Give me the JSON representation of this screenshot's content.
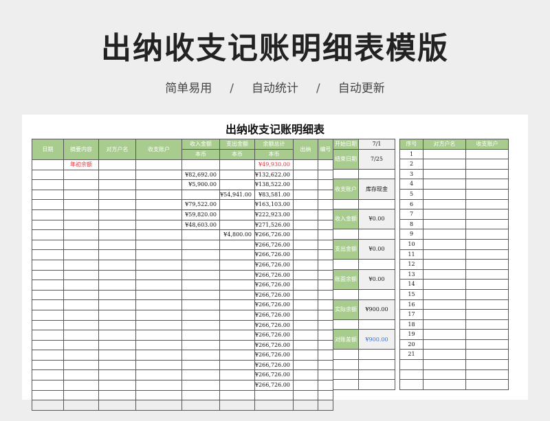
{
  "header": {
    "title": "出纳收支记账明细表模版",
    "tags": [
      "简单易用",
      "自动统计",
      "自动更新"
    ],
    "sep": "/"
  },
  "sheet": {
    "title": "出纳收支记账明细表",
    "columns": [
      "日期",
      "摘要内容",
      "对方户名",
      "收支账户",
      "收入金额",
      "支出金额",
      "余额总计",
      "出纳",
      "编号"
    ],
    "sub_currency": "本币",
    "opening_label": "年初余额",
    "opening_balance": "¥49,930.00",
    "rows": [
      {
        "income": "¥82,692.00",
        "expense": "",
        "balance": "¥132,622.00"
      },
      {
        "income": "¥5,900.00",
        "expense": "",
        "balance": "¥138,522.00"
      },
      {
        "income": "",
        "expense": "¥54,941.00",
        "balance": "¥83,581.00"
      },
      {
        "income": "¥79,522.00",
        "expense": "",
        "balance": "¥163,103.00"
      },
      {
        "income": "¥59,820.00",
        "expense": "",
        "balance": "¥222,923.00"
      },
      {
        "income": "¥48,603.00",
        "expense": "",
        "balance": "¥271,526.00"
      },
      {
        "income": "",
        "expense": "¥4,800.00",
        "balance": "¥266,726.00"
      },
      {
        "income": "",
        "expense": "",
        "balance": "¥266,726.00"
      },
      {
        "income": "",
        "expense": "",
        "balance": "¥266,726.00"
      },
      {
        "income": "",
        "expense": "",
        "balance": "¥266,726.00"
      },
      {
        "income": "",
        "expense": "",
        "balance": "¥266,726.00"
      },
      {
        "income": "",
        "expense": "",
        "balance": "¥266,726.00"
      },
      {
        "income": "",
        "expense": "",
        "balance": "¥266,726.00"
      },
      {
        "income": "",
        "expense": "",
        "balance": "¥266,726.00"
      },
      {
        "income": "",
        "expense": "",
        "balance": "¥266,726.00"
      },
      {
        "income": "",
        "expense": "",
        "balance": "¥266,726.00"
      },
      {
        "income": "",
        "expense": "",
        "balance": "¥266,726.00"
      },
      {
        "income": "",
        "expense": "",
        "balance": "¥266,726.00"
      },
      {
        "income": "",
        "expense": "",
        "balance": "¥266,726.00"
      },
      {
        "income": "",
        "expense": "",
        "balance": "¥266,726.00"
      },
      {
        "income": "",
        "expense": "",
        "balance": "¥266,726.00"
      },
      {
        "income": "",
        "expense": "",
        "balance": "¥266,726.00"
      },
      {
        "income": "",
        "expense": "",
        "balance": ""
      },
      {
        "income": "",
        "expense": "",
        "balance": ""
      }
    ]
  },
  "summary": {
    "start_label": "开始日期",
    "start_value": "7/1",
    "items": [
      {
        "label": "结束日期",
        "value": "7/25",
        "color": "#111111"
      },
      {
        "label": "收支账户",
        "value": "库存现金",
        "color": "#111111"
      },
      {
        "label": "收入金额",
        "value": "¥0.00",
        "color": "#111111"
      },
      {
        "label": "支出金额",
        "value": "¥0.00",
        "color": "#111111"
      },
      {
        "label": "账面余额",
        "value": "¥0.00",
        "color": "#111111"
      },
      {
        "label": "实际余额",
        "value": "¥900.00",
        "color": "#111111"
      },
      {
        "label": "对账差额",
        "value": "¥900.00",
        "color": "#3b6fd6"
      }
    ]
  },
  "lookup": {
    "columns": [
      "序号",
      "对方户名",
      "收支账户"
    ],
    "numbers": [
      "1",
      "2",
      "3",
      "4",
      "5",
      "6",
      "7",
      "8",
      "9",
      "10",
      "11",
      "12",
      "13",
      "14",
      "15",
      "16",
      "17",
      "18",
      "19",
      "20",
      "21"
    ]
  },
  "colors": {
    "accent": "#a7cc8e",
    "red": "#e0353b",
    "blue": "#3b6fd6"
  }
}
